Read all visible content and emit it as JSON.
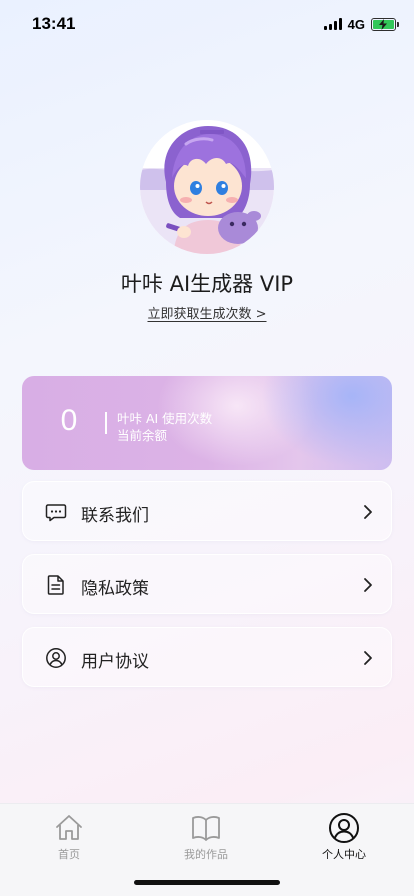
{
  "status_bar": {
    "time": "13:41",
    "network": "4G"
  },
  "profile": {
    "title": "叶咔 AI生成器 VIP",
    "get_link": "立即获取生成次数 >"
  },
  "usage_card": {
    "count": "0",
    "label": "叶咔 AI 使用次数",
    "sub_label": "当前余额"
  },
  "menu": [
    {
      "label": "联系我们",
      "icon": "chat-icon"
    },
    {
      "label": "隐私政策",
      "icon": "document-icon"
    },
    {
      "label": "用户协议",
      "icon": "user-circle-icon"
    }
  ],
  "tab_bar": {
    "tabs": [
      {
        "label": "首页",
        "icon": "home-icon",
        "active": false
      },
      {
        "label": "我的作品",
        "icon": "book-icon",
        "active": false
      },
      {
        "label": "个人中心",
        "icon": "profile-icon",
        "active": true
      }
    ]
  },
  "colors": {
    "card_gradient_start": "#d8aee5",
    "card_gradient_end": "#a4b4f8",
    "battery": "#32c759"
  }
}
